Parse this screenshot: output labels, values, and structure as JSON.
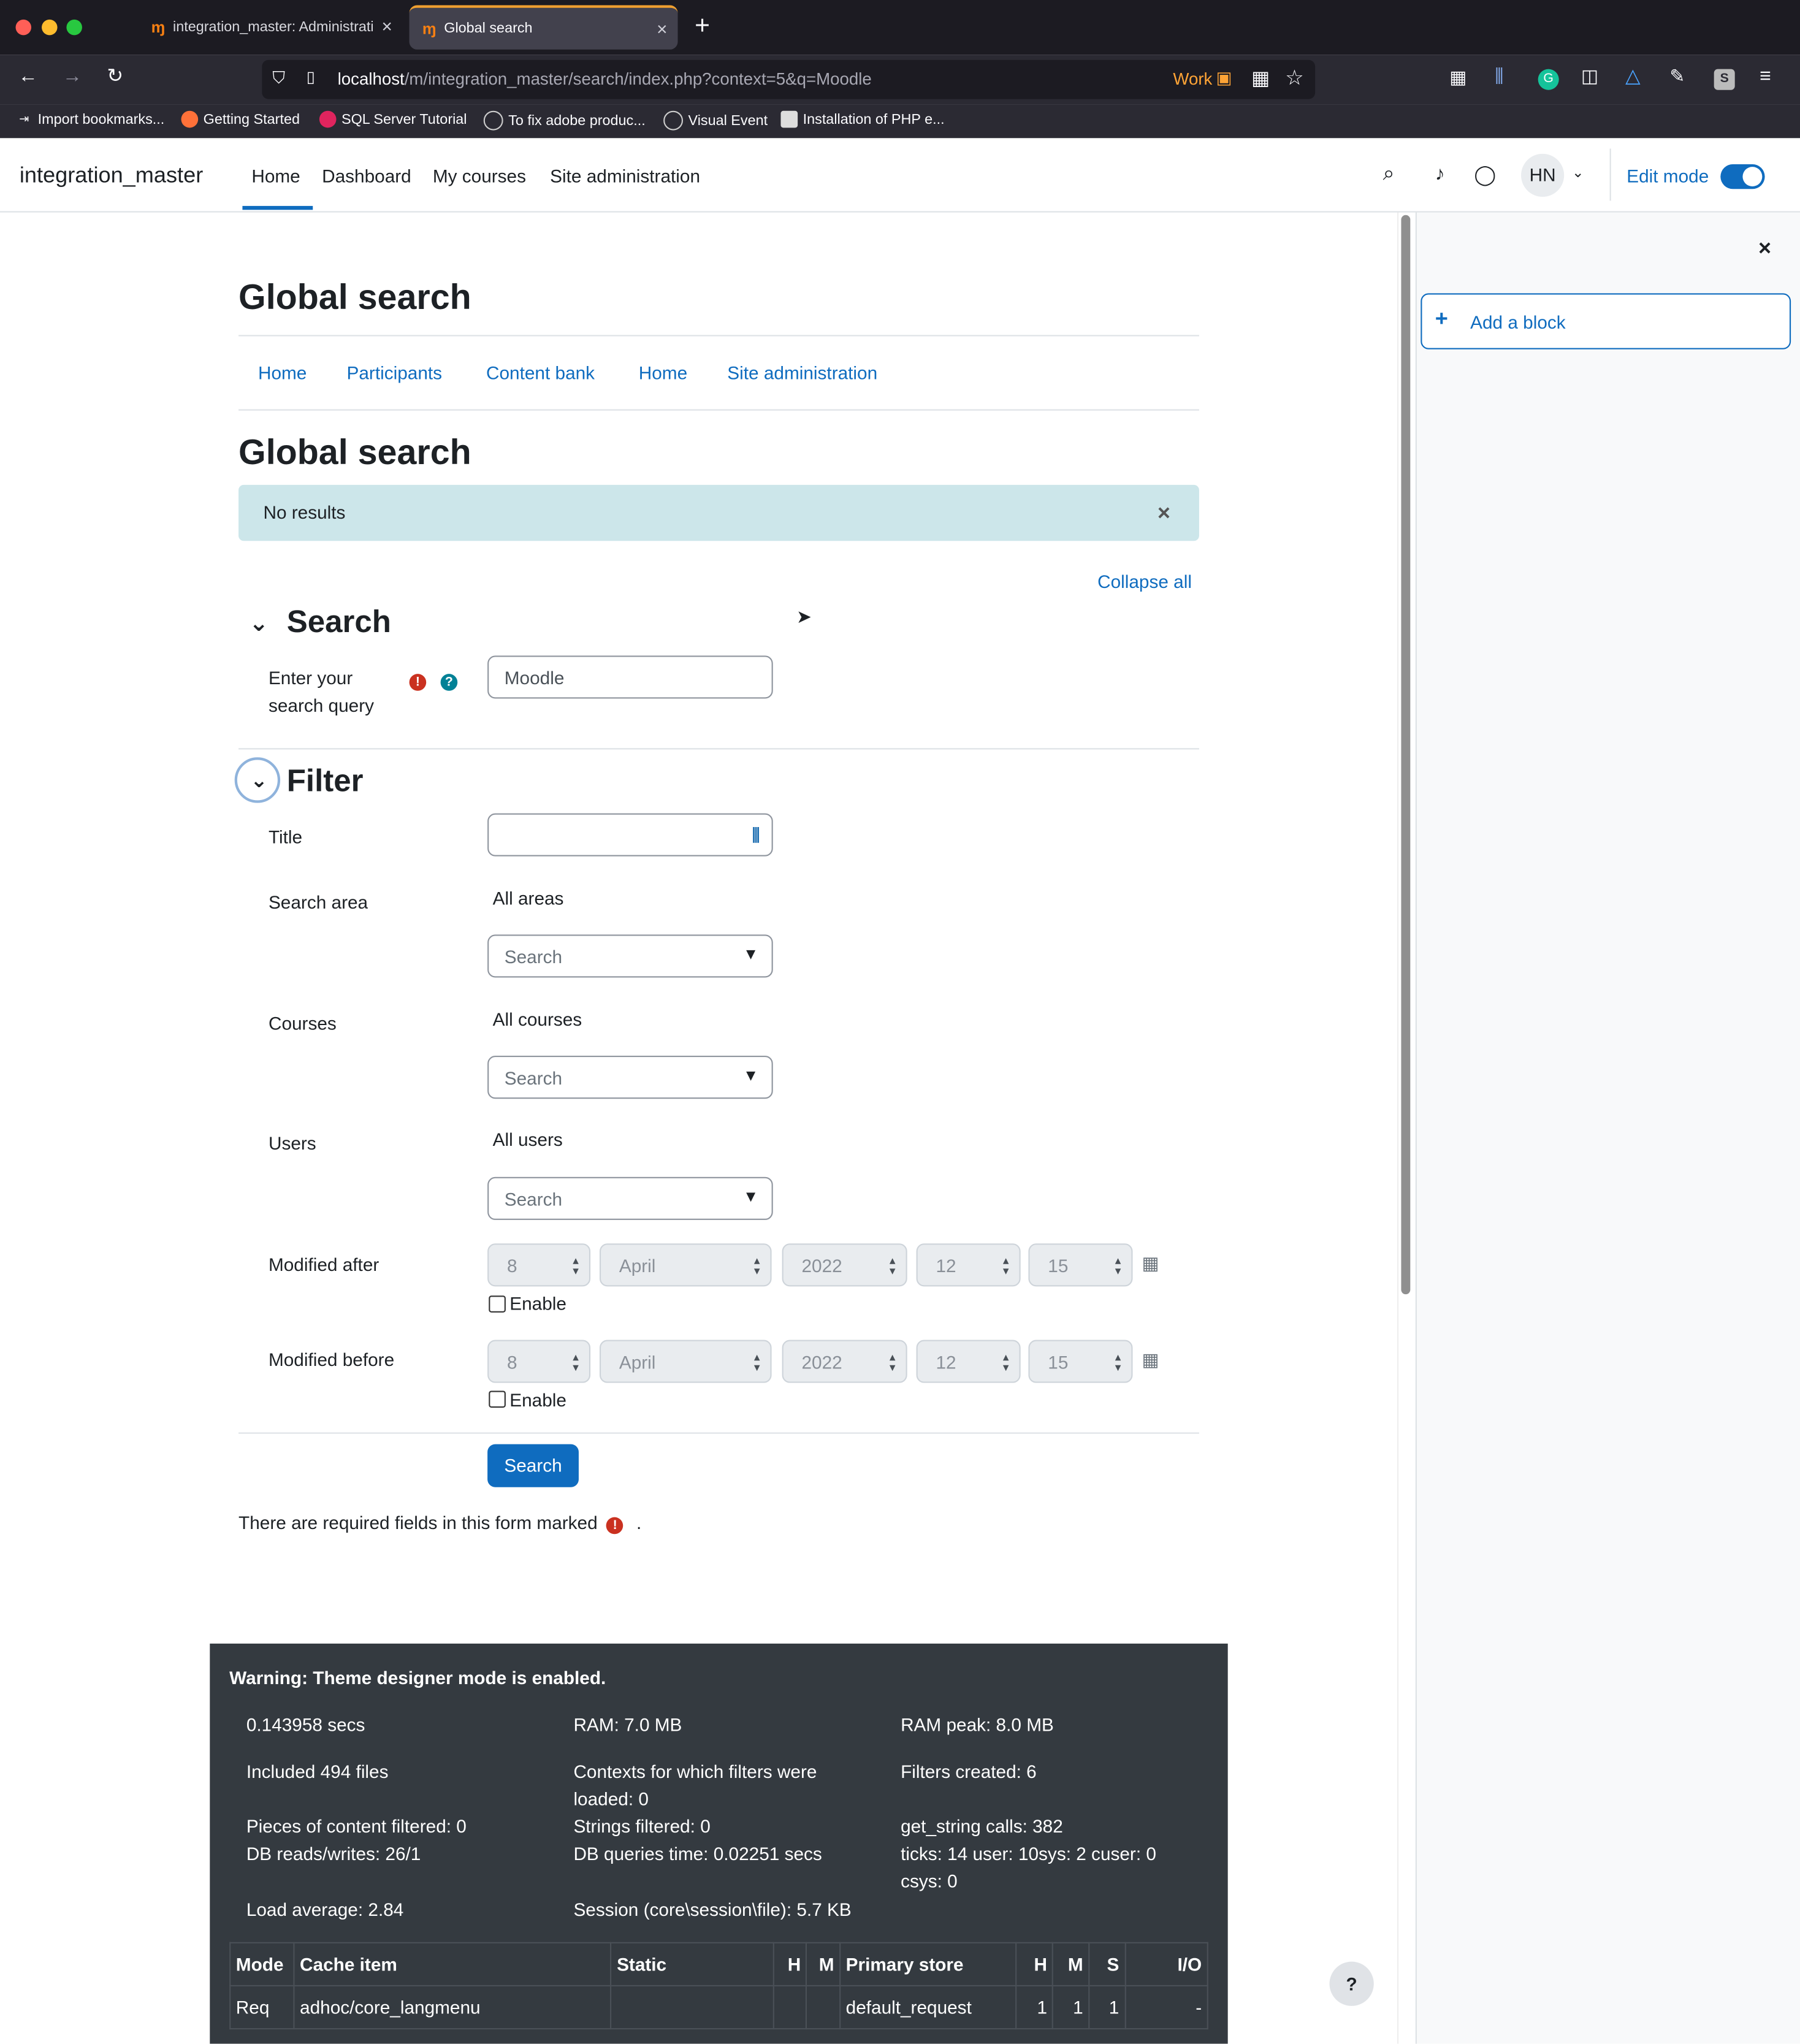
{
  "browser": {
    "tabs": [
      {
        "label": "integration_master: Administrati",
        "active": false
      },
      {
        "label": "Global search",
        "active": true
      }
    ],
    "url_host": "localhost",
    "url_path": "/m/integration_master/search/index.php?context=5&q=Moodle",
    "container_label": "Work",
    "bookmarks": [
      {
        "label": "Import bookmarks..."
      },
      {
        "label": "Getting Started"
      },
      {
        "label": "SQL Server Tutorial"
      },
      {
        "label": "To fix adobe produc..."
      },
      {
        "label": "Visual Event"
      },
      {
        "label": "Installation of PHP e..."
      }
    ]
  },
  "navbar": {
    "brand": "integration_master",
    "links": [
      "Home",
      "Dashboard",
      "My courses",
      "Site administration"
    ],
    "avatar_initials": "HN",
    "edit_mode_label": "Edit mode",
    "edit_mode_on": true
  },
  "page": {
    "heading": "Global search",
    "secondary_nav": [
      "Home",
      "Participants",
      "Content bank",
      "Home",
      "Site administration"
    ],
    "subheading": "Global search",
    "alert_text": "No results",
    "collapse_all": "Collapse all"
  },
  "form": {
    "search_section": "Search",
    "query_label_line1": "Enter your",
    "query_label_line2": "search query",
    "query_value": "Moodle",
    "filter_section": "Filter",
    "title_label": "Title",
    "title_value": "",
    "area_label": "Search area",
    "area_value": "All areas",
    "area_placeholder": "Search",
    "courses_label": "Courses",
    "courses_value": "All courses",
    "courses_placeholder": "Search",
    "users_label": "Users",
    "users_value": "All users",
    "users_placeholder": "Search",
    "after_label": "Modified after",
    "before_label": "Modified before",
    "date": {
      "day": "8",
      "month": "April",
      "year": "2022",
      "hour": "12",
      "minute": "15"
    },
    "enable_label": "Enable",
    "submit_label": "Search",
    "required_note": "There are required fields in this form marked",
    "required_note_end": "."
  },
  "drawer": {
    "add_block_label": "Add a block"
  },
  "perf": {
    "warning": "Warning: Theme designer mode is enabled.",
    "col1": [
      "0.143958 secs",
      "Included 494 files",
      "Pieces of content filtered: 0",
      "DB reads/writes: 26/1",
      "Load average: 2.84"
    ],
    "col2": [
      "RAM: 7.0 MB",
      "Contexts for which filters were",
      "loaded: 0",
      "Strings filtered: 0",
      "DB queries time: 0.02251 secs",
      "Session (core\\session\\file): 5.7 KB"
    ],
    "col3": [
      "RAM peak: 8.0 MB",
      "Filters created: 6",
      "get_string calls: 382",
      "ticks: 14 user: 10sys: 2 cuser: 0",
      "csys: 0"
    ],
    "table_headers": [
      "Mode",
      "Cache item",
      "Static",
      "H",
      "M",
      "Primary store",
      "H",
      "M",
      "S",
      "I/O"
    ],
    "rows": [
      [
        "Req",
        "adhoc/core_langmenu",
        "",
        "",
        "",
        "default_request",
        "1",
        "1",
        "1",
        "-"
      ]
    ]
  },
  "help_button": "?"
}
